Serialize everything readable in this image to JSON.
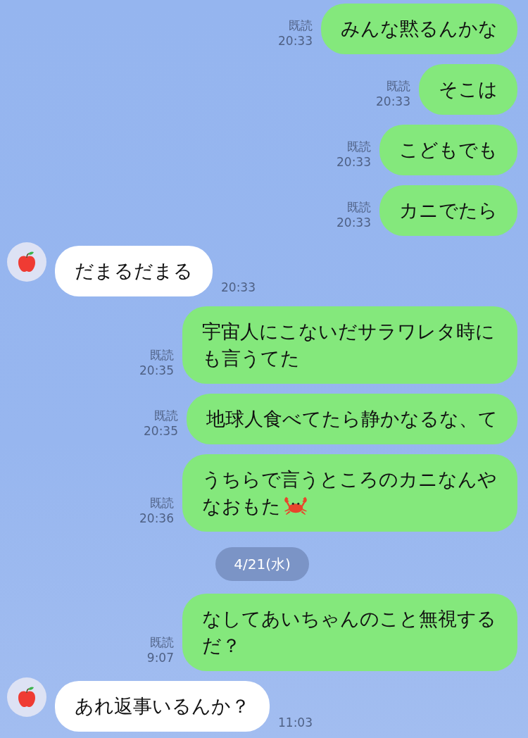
{
  "messages": [
    {
      "kind": "outgoing",
      "text": "みんな黙るんかな",
      "read": "既読",
      "time": "20:33"
    },
    {
      "kind": "outgoing",
      "text": "そこは",
      "read": "既読",
      "time": "20:33"
    },
    {
      "kind": "outgoing",
      "text": "こどもでも",
      "read": "既読",
      "time": "20:33"
    },
    {
      "kind": "outgoing",
      "text": "カニでたら",
      "read": "既読",
      "time": "20:33"
    },
    {
      "kind": "incoming",
      "text": "だまるだまる",
      "time": "20:33"
    },
    {
      "kind": "outgoing",
      "text": "宇宙人にこないだサラワレタ時にも言うてた",
      "read": "既読",
      "time": "20:35"
    },
    {
      "kind": "outgoing",
      "text": "地球人食べてたら静かなるな、て",
      "read": "既読",
      "time": "20:35"
    },
    {
      "kind": "outgoing_crab",
      "text": "うちらで言うところのカニなんやなおもた",
      "read": "既読",
      "time": "20:36"
    },
    {
      "kind": "date",
      "text": "4/21(水)"
    },
    {
      "kind": "outgoing",
      "text": "なしてあいちゃんのこと無視するだ？",
      "read": "既読",
      "time": "9:07"
    },
    {
      "kind": "incoming",
      "text": "あれ返事いるんか？",
      "time": "11:03"
    }
  ]
}
